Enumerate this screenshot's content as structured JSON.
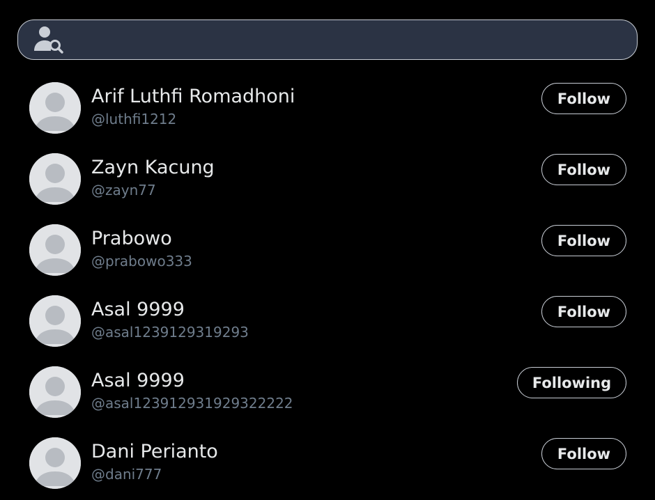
{
  "search": {
    "placeholder": "",
    "icon": "user-search-icon"
  },
  "users": [
    {
      "name": "Arif Luthfi Romadhoni",
      "handle": "@luthfi1212",
      "button": "Follow"
    },
    {
      "name": "Zayn Kacung",
      "handle": "@zayn77",
      "button": "Follow"
    },
    {
      "name": "Prabowo",
      "handle": "@prabowo333",
      "button": "Follow"
    },
    {
      "name": "Asal 9999",
      "handle": "@asal1239129319293",
      "button": "Follow"
    },
    {
      "name": "Asal 9999",
      "handle": "@asal123912931929322222",
      "button": "Following"
    },
    {
      "name": "Dani Perianto",
      "handle": "@dani777",
      "button": "Follow"
    }
  ],
  "colors": {
    "background": "#000000",
    "search_fill": "#2b3344",
    "border": "#c9ced6",
    "handle": "#6f7d8c",
    "avatar_bg": "#e1e3e6",
    "avatar_fg": "#b8bcc2"
  }
}
